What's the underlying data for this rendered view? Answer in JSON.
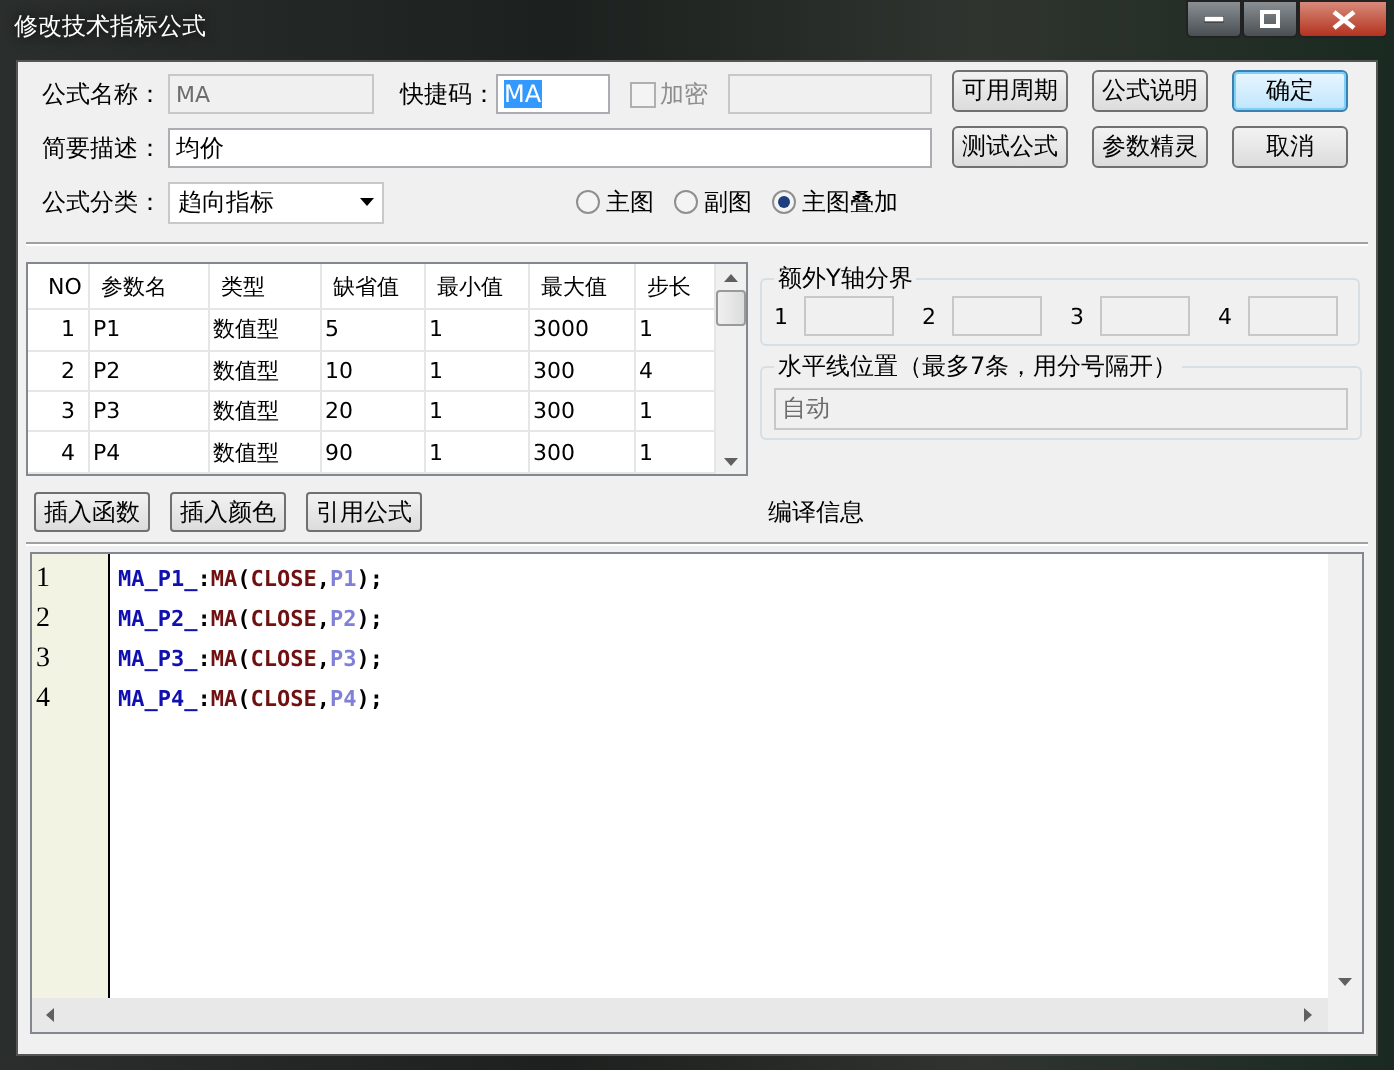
{
  "window": {
    "title": "修改技术指标公式"
  },
  "form": {
    "name": {
      "label": "公式名称：",
      "value": "MA",
      "disabled": true
    },
    "hotkey": {
      "label": "快捷码：",
      "value": "MA",
      "highlighted": true
    },
    "encrypt": {
      "label": "加密",
      "checked": false,
      "disabled": true
    },
    "password": {
      "disabled": true
    },
    "description": {
      "label": "简要描述：",
      "value": "均价"
    },
    "category": {
      "label": "公式分类：",
      "value": "趋向指标"
    },
    "chart_modes": [
      {
        "label": "主图",
        "selected": false
      },
      {
        "label": "副图",
        "selected": false
      },
      {
        "label": "主图叠加",
        "selected": true
      }
    ]
  },
  "buttons": [
    {
      "label": "可用周期",
      "default": false
    },
    {
      "label": "公式说明",
      "default": false
    },
    {
      "label": "确定",
      "default": true
    },
    {
      "label": "测试公式",
      "default": false
    },
    {
      "label": "参数精灵",
      "default": false
    },
    {
      "label": "取消",
      "default": false
    }
  ],
  "params": {
    "columns": [
      "NO",
      "参数名",
      "类型",
      "缺省值",
      "最小值",
      "最大值",
      "步长"
    ],
    "rows": [
      [
        "1",
        "P1",
        "数值型",
        "5",
        "1",
        "3000",
        "1"
      ],
      [
        "2",
        "P2",
        "数值型",
        "10",
        "1",
        "300",
        "4"
      ],
      [
        "3",
        "P3",
        "数值型",
        "20",
        "1",
        "300",
        "1"
      ],
      [
        "4",
        "P4",
        "数值型",
        "90",
        "1",
        "300",
        "1"
      ]
    ]
  },
  "y_axis": {
    "title": "额外Y轴分界",
    "fields": [
      "1",
      "2",
      "3",
      "4"
    ]
  },
  "hlines": {
    "title": "水平线位置（最多7条，用分号隔开）",
    "value": "自动",
    "disabled": true
  },
  "tools": [
    "插入函数",
    "插入颜色",
    "引用公式"
  ],
  "compile_label": "编译信息",
  "editor": {
    "lines": [
      {
        "number": "1",
        "tokens": [
          {
            "text": "MA_P1_",
            "kind": "var"
          },
          {
            "text": ":",
            "kind": "punct"
          },
          {
            "text": "MA",
            "kind": "func"
          },
          {
            "text": "(",
            "kind": "punct"
          },
          {
            "text": "CLOSE",
            "kind": "func"
          },
          {
            "text": ",",
            "kind": "punct"
          },
          {
            "text": "P1",
            "kind": "param"
          },
          {
            "text": ");",
            "kind": "punct"
          }
        ]
      },
      {
        "number": "2",
        "tokens": [
          {
            "text": "MA_P2_",
            "kind": "var"
          },
          {
            "text": ":",
            "kind": "punct"
          },
          {
            "text": "MA",
            "kind": "func"
          },
          {
            "text": "(",
            "kind": "punct"
          },
          {
            "text": "CLOSE",
            "kind": "func"
          },
          {
            "text": ",",
            "kind": "punct"
          },
          {
            "text": "P2",
            "kind": "param"
          },
          {
            "text": ");",
            "kind": "punct"
          }
        ]
      },
      {
        "number": "3",
        "tokens": [
          {
            "text": "MA_P3_",
            "kind": "var"
          },
          {
            "text": ":",
            "kind": "punct"
          },
          {
            "text": "MA",
            "kind": "func"
          },
          {
            "text": "(",
            "kind": "punct"
          },
          {
            "text": "CLOSE",
            "kind": "func"
          },
          {
            "text": ",",
            "kind": "punct"
          },
          {
            "text": "P3",
            "kind": "param"
          },
          {
            "text": ");",
            "kind": "punct"
          }
        ]
      },
      {
        "number": "4",
        "tokens": [
          {
            "text": "MA_P4_",
            "kind": "var"
          },
          {
            "text": ":",
            "kind": "punct"
          },
          {
            "text": "MA",
            "kind": "func"
          },
          {
            "text": "(",
            "kind": "punct"
          },
          {
            "text": "CLOSE",
            "kind": "func"
          },
          {
            "text": ",",
            "kind": "punct"
          },
          {
            "text": "P4",
            "kind": "param"
          },
          {
            "text": ");",
            "kind": "punct"
          }
        ]
      }
    ]
  }
}
